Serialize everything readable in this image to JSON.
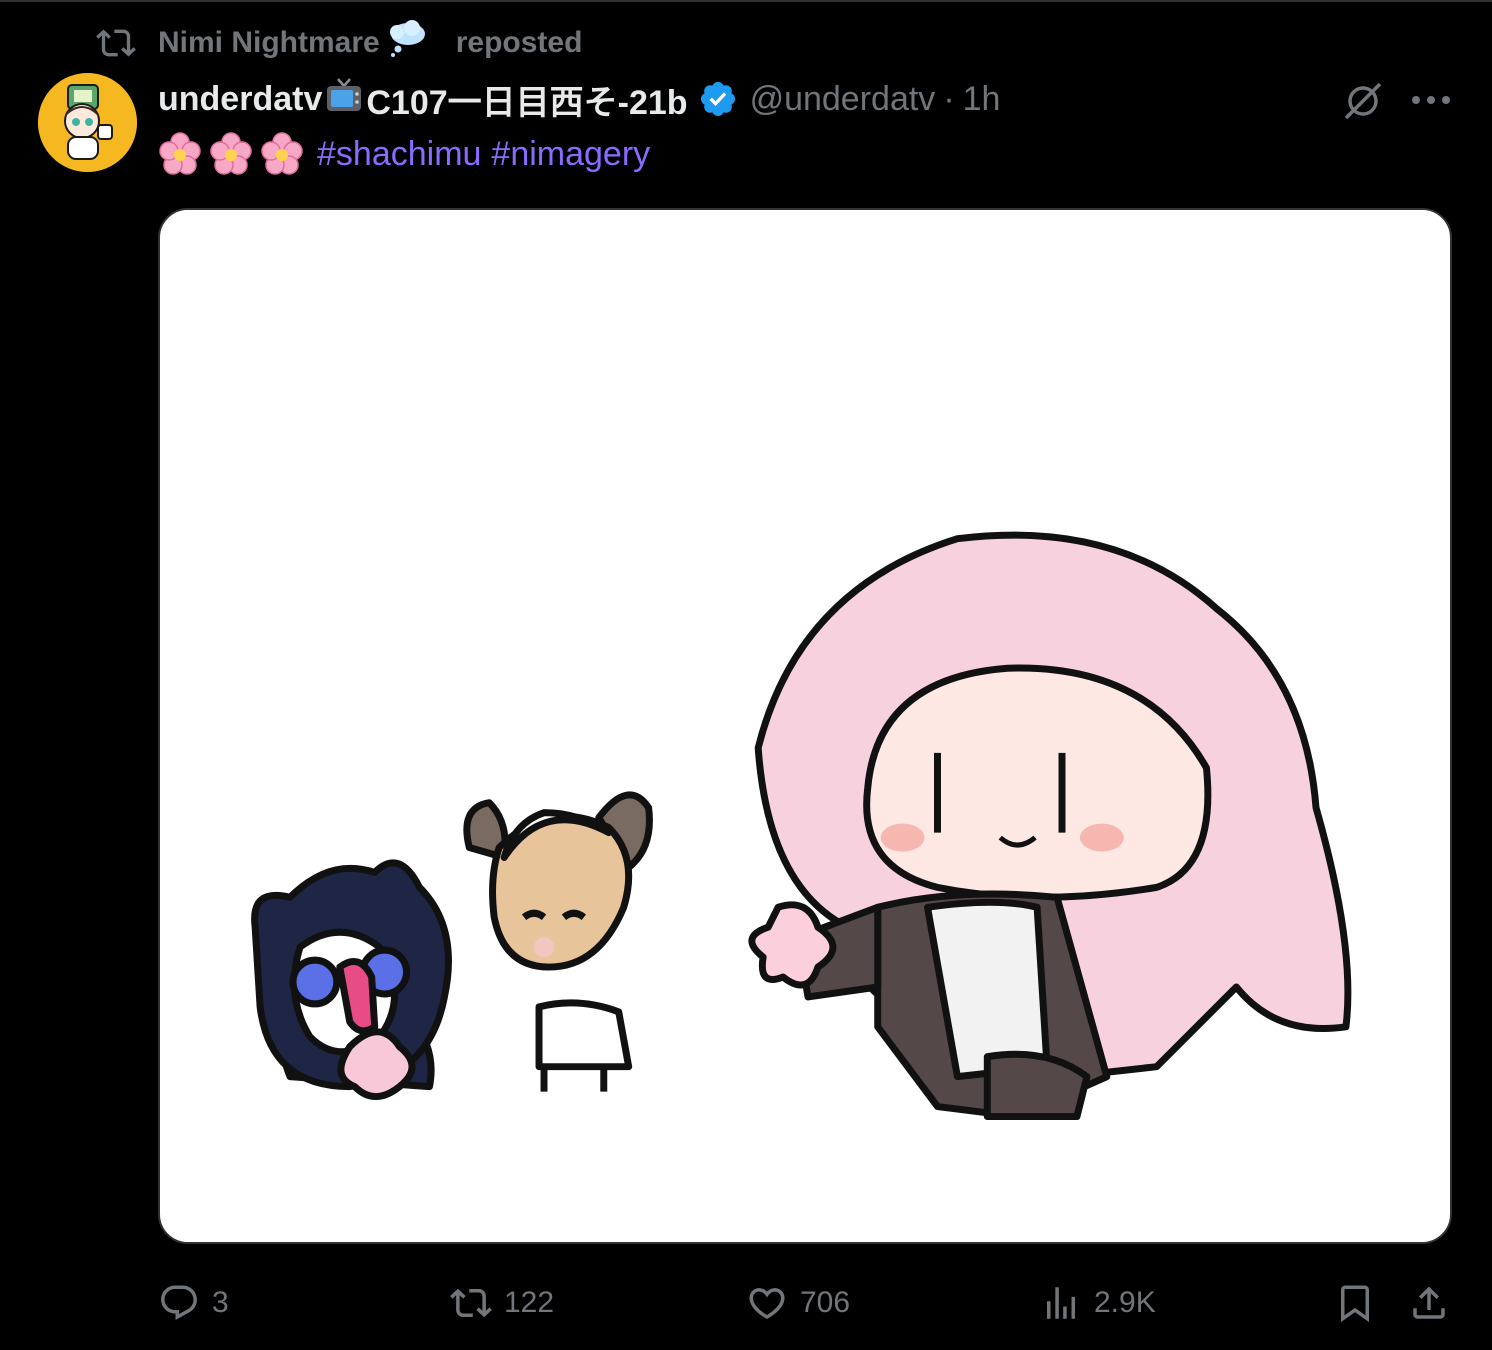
{
  "repost": {
    "reposter_name": "Nimi Nightmare",
    "reposter_emoji": "thought-balloon-icon",
    "label": "reposted"
  },
  "post": {
    "display_name": "underdatv",
    "display_name_suffix": "C107一日目西そ-21b",
    "handle": "@underdatv",
    "separator": "·",
    "time": "1h",
    "verified": true,
    "text_emojis": [
      "cherry-blossom-icon",
      "cherry-blossom-icon",
      "cherry-blossom-icon"
    ],
    "hashtags": [
      "#shachimu",
      "#nimagery"
    ],
    "media_description_alt": "chibi illustration"
  },
  "actions": {
    "replies": "3",
    "reposts": "122",
    "likes": "706",
    "views": "2.9K"
  },
  "colors": {
    "background": "#000000",
    "text_primary": "#e7e9ea",
    "text_secondary": "#71767b",
    "hashtag": "#8b6bff",
    "verified": "#1d9bf0",
    "avatar_bg": "#f5b820"
  }
}
